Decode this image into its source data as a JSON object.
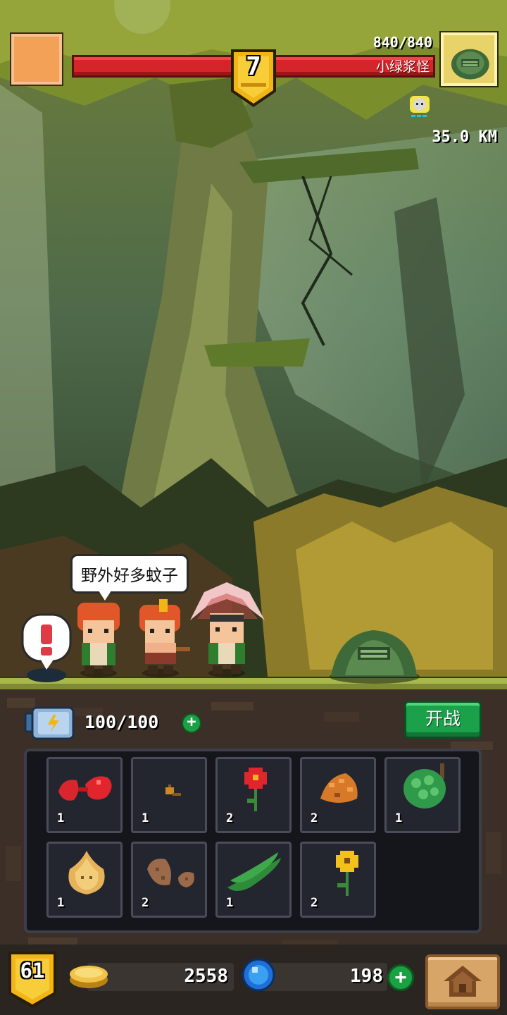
{
  "hud": {
    "boss_hp": "840/840",
    "enemy_name": "小绿浆怪",
    "stage_level": "7",
    "distance": "35.0 KM"
  },
  "dialog": {
    "speech": "野外好多蚊子"
  },
  "energy": {
    "value": "100/100",
    "plus_label": "+"
  },
  "battle_button": {
    "label": "开战"
  },
  "inventory": {
    "items": [
      {
        "icon": "red-meat-icon",
        "count": "1"
      },
      {
        "icon": "small-seed-icon",
        "count": "1"
      },
      {
        "icon": "red-flower-icon",
        "count": "2"
      },
      {
        "icon": "pine-cone-icon",
        "count": "2"
      },
      {
        "icon": "green-grapes-icon",
        "count": "1"
      },
      {
        "icon": "onion-icon",
        "count": "1"
      },
      {
        "icon": "potato-icon",
        "count": "2"
      },
      {
        "icon": "green-beans-icon",
        "count": "1"
      },
      {
        "icon": "yellow-flower-icon",
        "count": "2"
      }
    ]
  },
  "footer": {
    "player_level": "61",
    "gold": "2558",
    "gems": "198",
    "gem_plus_label": "+"
  },
  "colors": {
    "hp_bar": "#d4252a",
    "button_green": "#1aa14a",
    "badge_gold": "#f2b516",
    "menu_orange": "#f4a158"
  }
}
